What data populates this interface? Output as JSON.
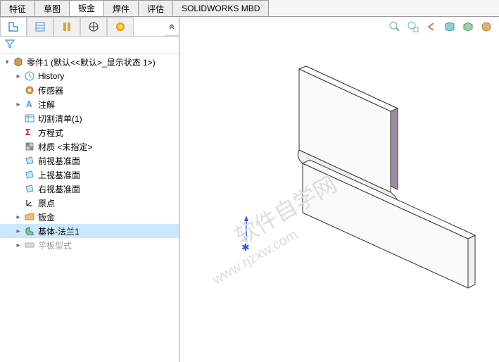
{
  "tabs": [
    {
      "id": "feature",
      "label": "特征",
      "active": false
    },
    {
      "id": "sketch",
      "label": "草图",
      "active": false
    },
    {
      "id": "sheetmetal",
      "label": "钣金",
      "active": true
    },
    {
      "id": "weldment",
      "label": "焊件",
      "active": false
    },
    {
      "id": "evaluate",
      "label": "评估",
      "active": false
    },
    {
      "id": "mbd",
      "label": "SOLIDWORKS MBD",
      "active": false
    }
  ],
  "tree": {
    "root": {
      "label": "零件1  (默认<<默认>_显示状态 1>)"
    },
    "items": [
      {
        "label": "History",
        "icon": "history",
        "expandable": true,
        "indent": 1
      },
      {
        "label": "传感器",
        "icon": "sensor",
        "indent": 1
      },
      {
        "label": "注解",
        "icon": "annotation",
        "expandable": true,
        "indent": 1
      },
      {
        "label": "切割清单(1)",
        "icon": "cutlist",
        "indent": 1
      },
      {
        "label": "方程式",
        "icon": "equation",
        "indent": 1
      },
      {
        "label": "材质 <未指定>",
        "icon": "material",
        "indent": 1
      },
      {
        "label": "前视基准面",
        "icon": "plane",
        "indent": 1
      },
      {
        "label": "上视基准面",
        "icon": "plane",
        "indent": 1
      },
      {
        "label": "右视基准面",
        "icon": "plane",
        "indent": 1
      },
      {
        "label": "原点",
        "icon": "origin",
        "indent": 1
      },
      {
        "label": "钣金",
        "icon": "sheetmetal-folder",
        "expandable": true,
        "indent": 1
      },
      {
        "label": "基体-法兰1",
        "icon": "base-flange",
        "expandable": true,
        "indent": 1,
        "selected": true
      },
      {
        "label": "平板型式",
        "icon": "flat-pattern",
        "expandable": true,
        "indent": 1,
        "dimmed": true
      }
    ]
  },
  "toolbar_icons": [
    "zoom-fit",
    "zoom-area",
    "prev-view",
    "section-view",
    "display-style",
    "appearance"
  ],
  "watermarks": [
    "软件自学网",
    "www.rjzxw.com"
  ]
}
